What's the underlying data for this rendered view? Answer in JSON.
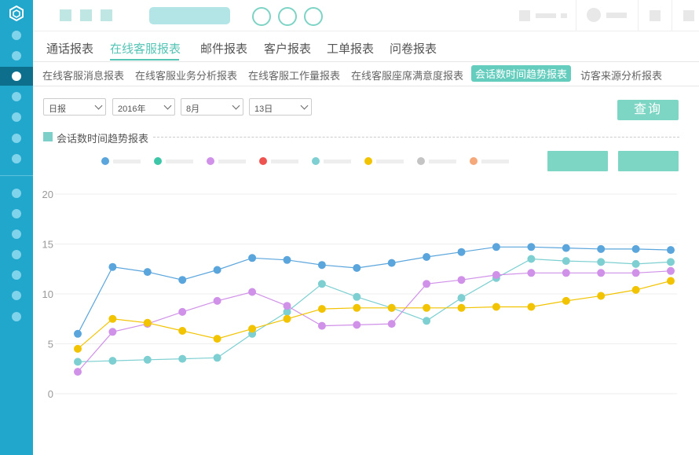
{
  "colors": {
    "sidebar": "#21a6cc",
    "accent": "#55c4b5",
    "button": "#7dd5c4"
  },
  "sidebar": {
    "icon": "hexagon-logo-icon",
    "active_index": 3
  },
  "tabs": [
    "通话报表",
    "在线客服报表",
    "邮件报表",
    "客户报表",
    "工单报表",
    "问卷报表"
  ],
  "active_tab": "在线客服报表",
  "subtabs": [
    "在线客服消息报表",
    "在线客服业务分析报表",
    "在线客服工作量报表",
    "在线客服座席满意度报表",
    "会话数时间趋势报表",
    "访客来源分析报表"
  ],
  "active_subtab": "会话数时间趋势报表",
  "filters": {
    "period": "日报",
    "year": "2016年",
    "month": "8月",
    "day": "13日"
  },
  "query_label": "查询",
  "chart_title": "会话数时间趋势报表",
  "legend_colors": [
    "#5aa5dc",
    "#3ec6a8",
    "#d091e8",
    "#ef5350",
    "#7dcfd1",
    "#f2c300",
    "#c4c4c4",
    "#f5a87a"
  ],
  "chart_data": {
    "type": "line",
    "title": "会话数时间趋势报表",
    "xlabel": "",
    "ylabel": "",
    "ylim": [
      0,
      20
    ],
    "yticks": [
      "0",
      "5",
      "10",
      "15",
      "20"
    ],
    "grid": true,
    "legend": "top",
    "x": [
      1,
      2,
      3,
      4,
      5,
      6,
      7,
      8,
      9,
      10,
      11,
      12,
      13,
      14,
      15,
      16,
      17,
      18,
      19,
      20
    ],
    "series": [
      {
        "color": "#5aa5dc",
        "values": [
          6.0,
          12.7,
          12.2,
          11.4,
          12.4,
          13.6,
          13.4,
          12.9,
          12.6,
          13.1,
          13.7,
          14.2,
          14.7,
          14.7,
          14.6,
          14.5,
          14.5,
          14.4
        ]
      },
      {
        "color": "#7dcfd1",
        "values": [
          3.2,
          3.3,
          3.4,
          3.5,
          3.6,
          6.0,
          8.2,
          11.0,
          9.7,
          8.6,
          7.3,
          9.6,
          11.6,
          13.5,
          13.3,
          13.2,
          13.0,
          13.2
        ]
      },
      {
        "color": "#d091e8",
        "values": [
          2.2,
          6.2,
          7.0,
          8.2,
          9.3,
          10.2,
          8.8,
          6.8,
          6.9,
          7.0,
          11.0,
          11.4,
          11.9,
          12.1,
          12.1,
          12.1,
          12.1,
          12.3
        ]
      },
      {
        "color": "#f2c300",
        "values": [
          4.5,
          7.5,
          7.1,
          6.3,
          5.5,
          6.5,
          7.5,
          8.5,
          8.6,
          8.6,
          8.6,
          8.6,
          8.7,
          8.7,
          9.3,
          9.8,
          10.4,
          11.3
        ]
      }
    ]
  }
}
